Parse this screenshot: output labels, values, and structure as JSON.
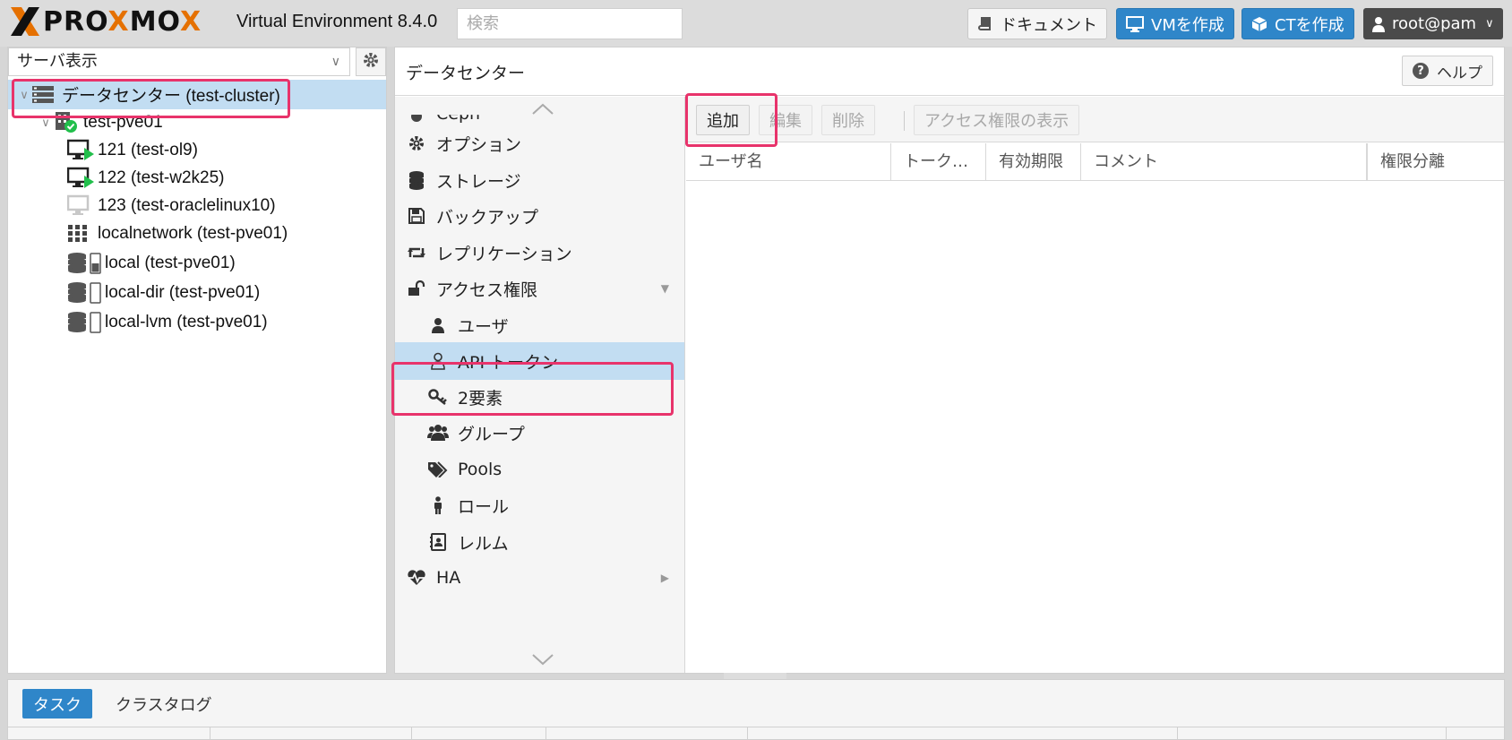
{
  "header": {
    "brand": "PROXMOX",
    "version": "Virtual Environment 8.4.0",
    "search_placeholder": "検索",
    "docs_label": "ドキュメント",
    "create_vm_label": "VMを作成",
    "create_ct_label": "CTを作成",
    "user_label": "root@pam"
  },
  "sidebar": {
    "view_select": "サーバ表示",
    "tree": [
      {
        "label": "データセンター (test-cluster)",
        "icon": "datacenter-icon",
        "selected": true
      },
      {
        "label": "test-pve01",
        "icon": "node-online-icon"
      },
      {
        "label": "121 (test-ol9)",
        "icon": "vm-running-icon"
      },
      {
        "label": "122 (test-w2k25)",
        "icon": "vm-running-icon"
      },
      {
        "label": "123 (test-oraclelinux10)",
        "icon": "vm-stopped-icon"
      },
      {
        "label": "localnetwork (test-pve01)",
        "icon": "network-grid-icon"
      },
      {
        "label": "local (test-pve01)",
        "icon": "storage-icon"
      },
      {
        "label": "local-dir (test-pve01)",
        "icon": "storage-icon"
      },
      {
        "label": "local-lvm (test-pve01)",
        "icon": "storage-icon"
      }
    ]
  },
  "main": {
    "title": "データセンター",
    "help_label": "ヘルプ",
    "menu": [
      {
        "label": "Ceph",
        "icon": "ceph-icon"
      },
      {
        "label": "オプション",
        "icon": "gear-icon"
      },
      {
        "label": "ストレージ",
        "icon": "database-icon"
      },
      {
        "label": "バックアップ",
        "icon": "floppy-icon"
      },
      {
        "label": "レプリケーション",
        "icon": "retweet-icon"
      },
      {
        "label": "アクセス権限",
        "icon": "unlock-icon"
      },
      {
        "label": "ユーザ",
        "icon": "user-icon"
      },
      {
        "label": "API トークン",
        "icon": "user-outline-icon",
        "selected": true
      },
      {
        "label": "2要素",
        "icon": "key-icon"
      },
      {
        "label": "グループ",
        "icon": "users-icon"
      },
      {
        "label": "Pools",
        "icon": "tags-icon"
      },
      {
        "label": "ロール",
        "icon": "male-icon"
      },
      {
        "label": "レルム",
        "icon": "address-book-icon"
      },
      {
        "label": "HA",
        "icon": "heartbeat-icon"
      }
    ],
    "toolbar": {
      "add": "追加",
      "edit": "編集",
      "delete": "削除",
      "show_permissions": "アクセス権限の表示"
    },
    "columns": [
      "ユーザ名",
      "トーク…",
      "有効期限",
      "コメント",
      "権限分離"
    ]
  },
  "bottom": {
    "tab_tasks": "タスク",
    "tab_cluster_log": "クラスタログ"
  },
  "colors": {
    "accent_blue": "#2f86c9",
    "selection": "#c2ddf2",
    "highlight": "#e8336b",
    "brand_orange": "#e57000"
  }
}
